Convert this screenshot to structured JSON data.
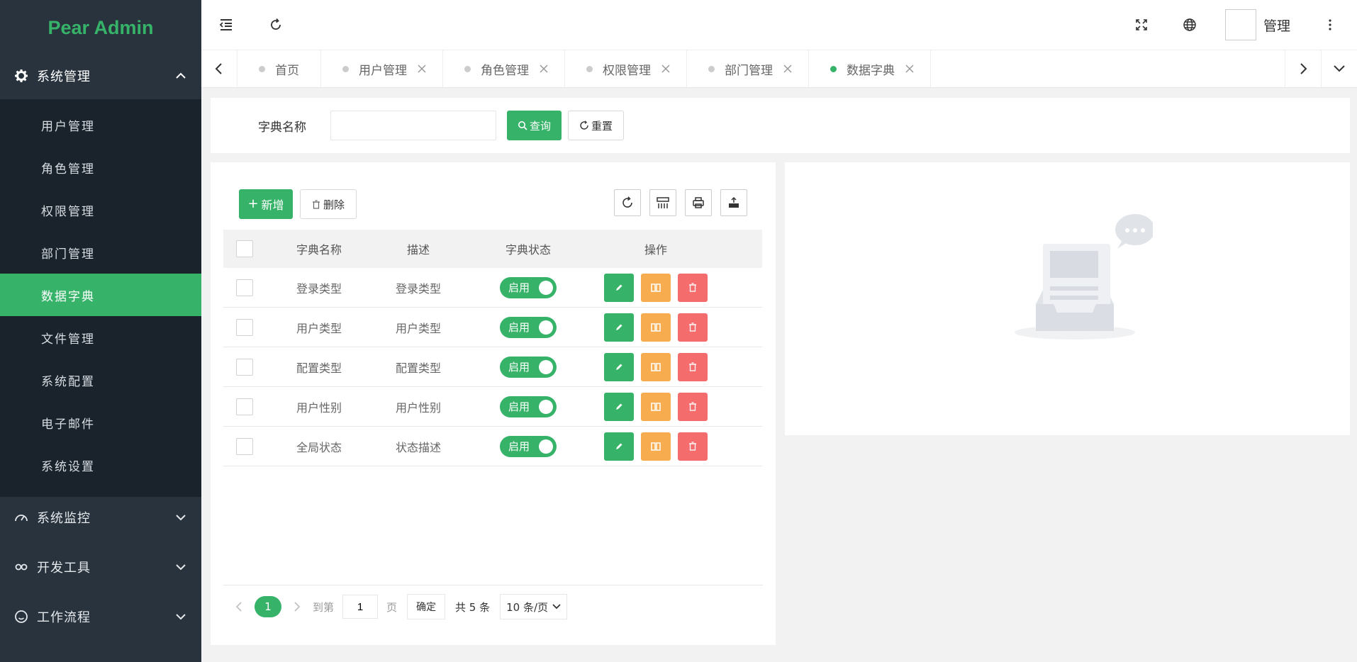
{
  "app": {
    "logo": "Pear Admin"
  },
  "sidebar": {
    "groups": [
      {
        "label": "系统管理",
        "icon": "gear-icon",
        "expanded": true
      },
      {
        "label": "系统监控",
        "icon": "dashboard-icon",
        "expanded": false
      },
      {
        "label": "开发工具",
        "icon": "link-icon",
        "expanded": false
      },
      {
        "label": "工作流程",
        "icon": "smile-icon",
        "expanded": false
      }
    ],
    "items": [
      "用户管理",
      "角色管理",
      "权限管理",
      "部门管理",
      "数据字典",
      "文件管理",
      "系统配置",
      "电子邮件",
      "系统设置"
    ],
    "active_item": "数据字典"
  },
  "header": {
    "user_name": "管理"
  },
  "tabs": [
    {
      "label": "首页",
      "closable": false
    },
    {
      "label": "用户管理",
      "closable": true
    },
    {
      "label": "角色管理",
      "closable": true
    },
    {
      "label": "权限管理",
      "closable": true
    },
    {
      "label": "部门管理",
      "closable": true
    },
    {
      "label": "数据字典",
      "closable": true,
      "active": true
    }
  ],
  "search": {
    "label": "字典名称",
    "value": "",
    "query_label": "查询",
    "reset_label": "重置"
  },
  "toolbar": {
    "add_label": "新增",
    "delete_label": "删除"
  },
  "table": {
    "columns": [
      "字典名称",
      "描述",
      "字典状态",
      "操作"
    ],
    "rows": [
      {
        "name": "登录类型",
        "desc": "登录类型",
        "status": "启用"
      },
      {
        "name": "用户类型",
        "desc": "用户类型",
        "status": "启用"
      },
      {
        "name": "配置类型",
        "desc": "配置类型",
        "status": "启用"
      },
      {
        "name": "用户性别",
        "desc": "用户性别",
        "status": "启用"
      },
      {
        "name": "全局状态",
        "desc": "状态描述",
        "status": "启用"
      }
    ]
  },
  "pager": {
    "current_page": "1",
    "goto_prefix": "到第",
    "goto_value": "1",
    "goto_suffix": "页",
    "confirm_label": "确定",
    "total_text": "共 5 条",
    "page_size_text": "10 条/页"
  },
  "colors": {
    "accent": "#36b368",
    "sidebar_bg": "#28333e",
    "submenu_bg": "#1a232c",
    "warning": "#f7ad4f",
    "danger": "#f56c6c"
  }
}
